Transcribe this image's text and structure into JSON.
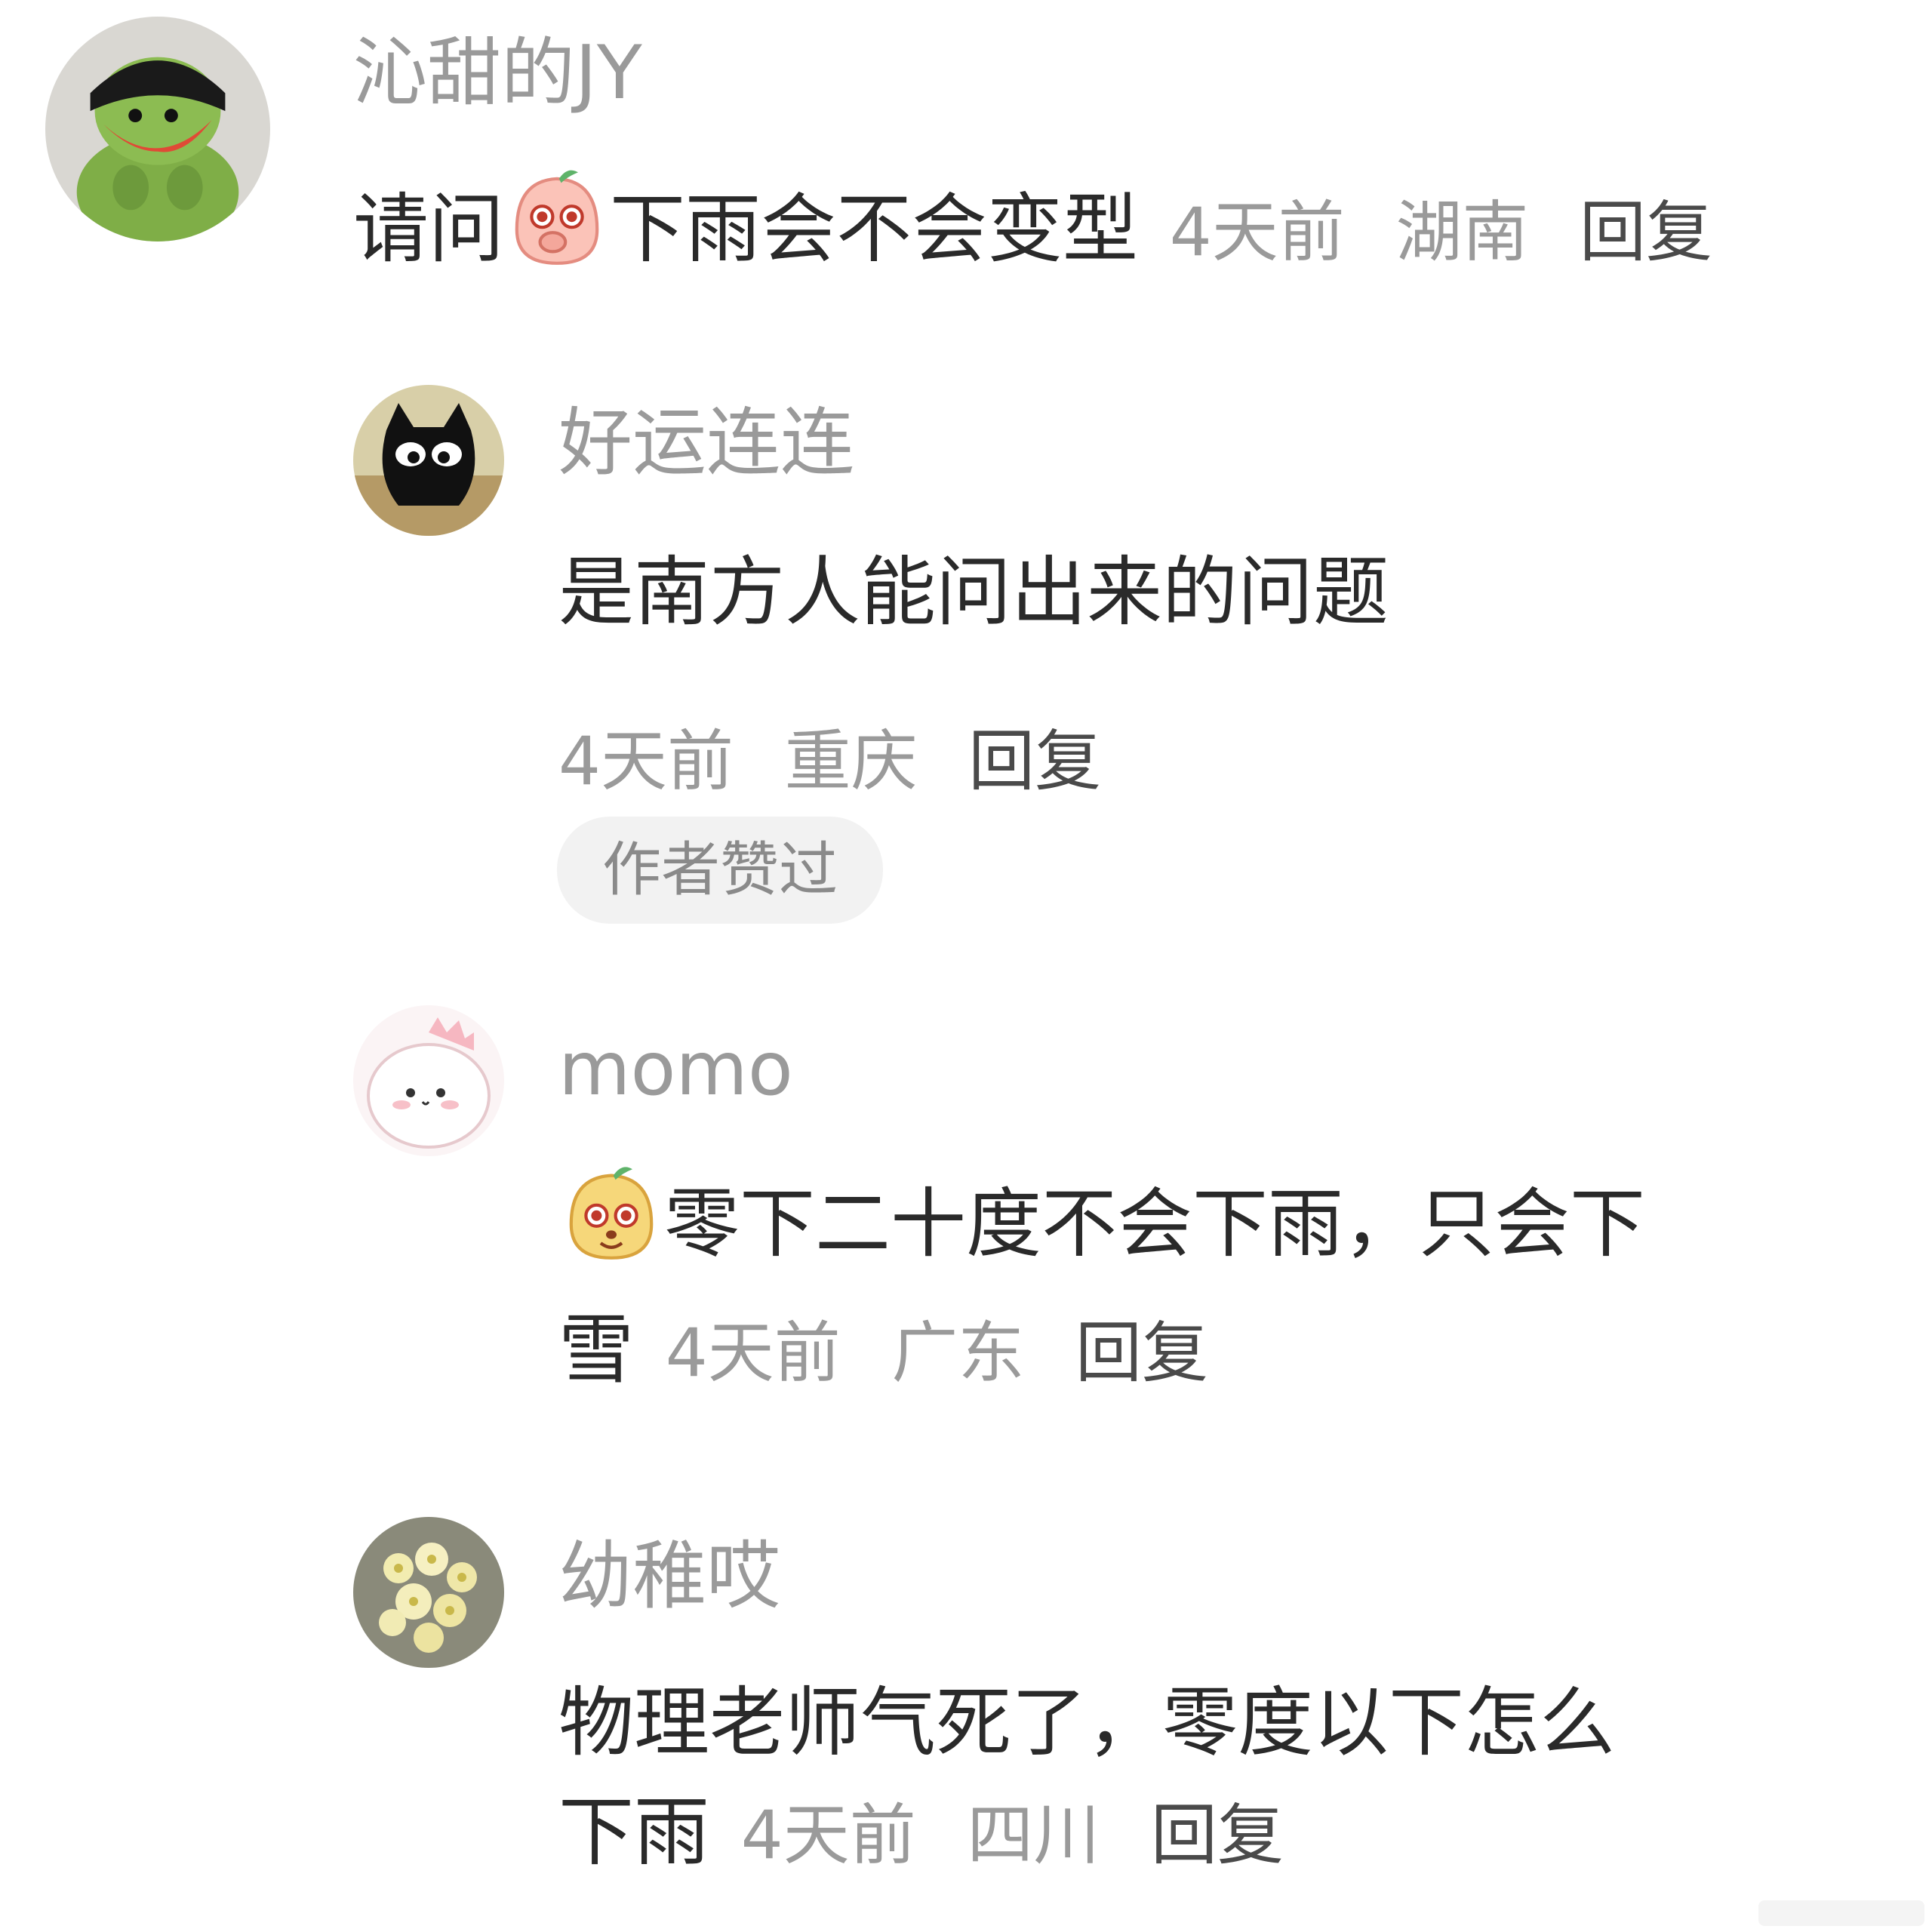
{
  "comments": [
    {
      "username": "沁甜的JY",
      "text_before": "请问",
      "emoji": "peach-cover-mouth-emoji",
      "text_after": "下雨会不会变型",
      "time": "4天前",
      "location": "湖南",
      "reply": "回复",
      "avatar": "green-plush-avatar"
    },
    {
      "username": "好运连连",
      "text": "是南方人能问出来的问题",
      "time": "4天前",
      "location": "重庆",
      "reply": "回复",
      "badge": "作者赞过",
      "avatar": "black-cat-avatar"
    },
    {
      "username": "momo",
      "emoji": "yellow-blob-emoji",
      "text_line1": "零下二十度不会下雨，只会下",
      "text_line2": "雪",
      "time": "4天前",
      "location": "广东",
      "reply": "回复",
      "avatar": "pink-dino-avatar"
    },
    {
      "username": "幼稚哎",
      "text_line1": "物理老师气死了，零度以下怎么",
      "text_line2": "下雨",
      "time": "4天前",
      "location": "四川",
      "reply": "回复",
      "avatar": "flowers-avatar"
    }
  ],
  "colors": {
    "background": "#ffffff",
    "username": "#9a9a9a",
    "text": "#2a2a2a",
    "meta": "#9a9a9a",
    "badge_bg": "#f2f2f2"
  }
}
